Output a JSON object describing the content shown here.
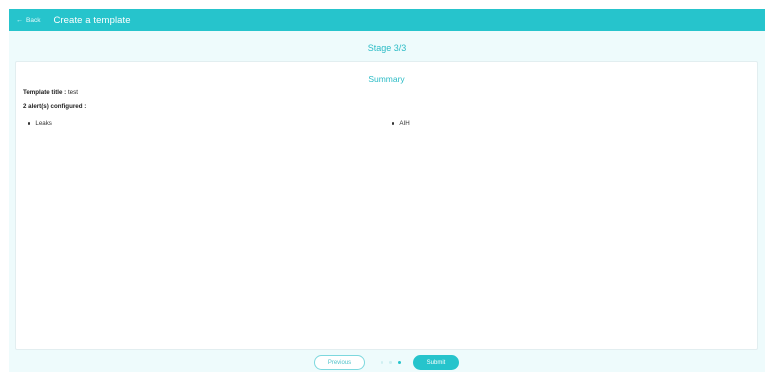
{
  "header": {
    "back_label": "Back",
    "title": "Create a template"
  },
  "stage": "Stage 3/3",
  "summary": {
    "title": "Summary",
    "template_title_label": "Template title :",
    "template_title_value": "test",
    "alerts_configured": "2 alert(s) configured :",
    "alerts": [
      "Leaks",
      "AIH"
    ]
  },
  "footer": {
    "previous_label": "Previous",
    "submit_label": "Submit",
    "steps_total": 3,
    "steps_current": 3
  }
}
